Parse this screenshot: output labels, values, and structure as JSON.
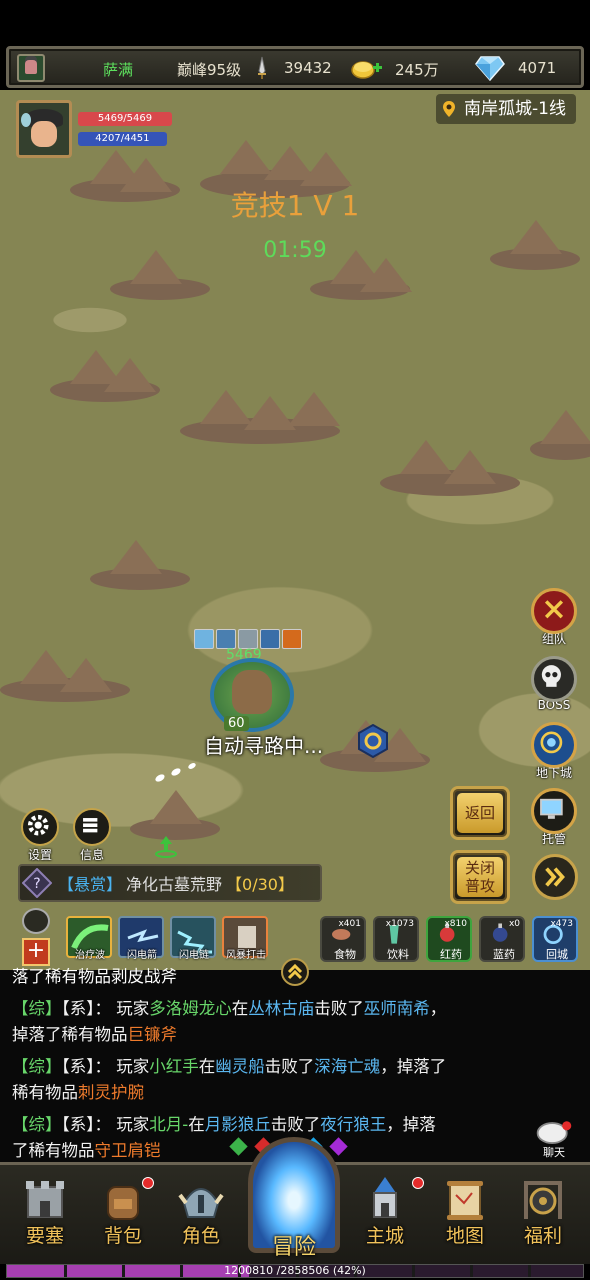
{
  "topbar": {
    "name": "萨满",
    "level": "巅峰95级",
    "power": "39432",
    "gold": "245万",
    "diamond": "4071"
  },
  "player": {
    "hp": "5469/5469",
    "mp": "4207/4451",
    "hp_fraction": 1.0,
    "mp_fraction": 0.945
  },
  "location": "南岸孤城-1线",
  "arena": {
    "title": "竞技1 V 1",
    "timer": "01:59"
  },
  "character": {
    "hp": "5469",
    "level": "60",
    "auto_path": "自动寻路中..."
  },
  "side_buttons": {
    "team": "组队",
    "boss": "BOSS",
    "dungeon": "地下城",
    "managed": "托管",
    "back": "返回",
    "normal_attack": "关闭\n普攻"
  },
  "util": {
    "settings": "设置",
    "info": "信息"
  },
  "quest": {
    "tag": "【悬赏】",
    "name": "净化古墓荒野",
    "progress": "【0/30】"
  },
  "skills": [
    {
      "label": "治疗波"
    },
    {
      "label": "闪电箭"
    },
    {
      "label": "闪电链"
    },
    {
      "label": "风暴打击"
    }
  ],
  "items": [
    {
      "label": "食物",
      "count": "x401"
    },
    {
      "label": "饮料",
      "count": "x1073"
    },
    {
      "label": "红药",
      "count": "x810"
    },
    {
      "label": "蓝药",
      "count": "x0"
    },
    {
      "label": "回城",
      "count": "x473"
    }
  ],
  "chat": {
    "line0": {
      "a": "落了稀有物品",
      "b": "剥皮战斧"
    },
    "messages": [
      {
        "tag1": "【综】",
        "tag2": "【系】",
        "p1": "：  玩家",
        "player": "多洛姆龙心",
        "p2": "在",
        "place": "丛林古庙",
        "p3": "击败了",
        "boss": "巫师南希",
        "p4": "，",
        "p5": "掉落了稀有物品",
        "item": "巨镰斧"
      },
      {
        "tag1": "【综】",
        "tag2": "【系】",
        "p1": "：  玩家",
        "player": "小红手",
        "p2": "在",
        "place": "幽灵船",
        "p3": "击败了",
        "boss": "深海亡魂",
        "p4": "，掉落了",
        "p5": "稀有物品",
        "item": "刺灵护腕"
      },
      {
        "tag1": "【综】",
        "tag2": "【系】",
        "p1": "：  玩家",
        "player": "北月-",
        "p2": "在",
        "place": "月影狼丘",
        "p3": "击败了",
        "boss": "夜行狼王",
        "p4": "，掉落",
        "p5": "了稀有物品",
        "item": "守卫肩铠"
      }
    ],
    "chat_button": "聊天"
  },
  "nav": {
    "fortress": "要塞",
    "bag": "背包",
    "role": "角色",
    "adventure": "冒险",
    "main_city": "主城",
    "map": "地图",
    "welfare": "福利"
  },
  "exp": {
    "text": "1200810 /2858506 (42%)",
    "fraction": 0.42
  },
  "colors": {
    "name_green": "#5de05d",
    "arena_orange": "#e9a03b",
    "timer_green": "#5edb5a",
    "exp_purple": "#a63fb1"
  }
}
